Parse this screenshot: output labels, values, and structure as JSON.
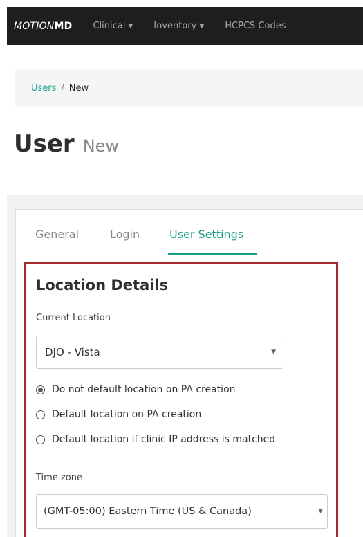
{
  "navbar": {
    "brand_part1": "MOTION",
    "brand_part2": "MD",
    "items": [
      {
        "label": "Clinical",
        "caret": "▼"
      },
      {
        "label": "Inventory",
        "caret": "▼"
      },
      {
        "label": "HCPCS Codes"
      }
    ]
  },
  "breadcrumb": {
    "link": "Users",
    "separator": "/",
    "current": "New"
  },
  "title": {
    "main": "User",
    "sub": "New"
  },
  "tabs": [
    {
      "label": "General",
      "active": false
    },
    {
      "label": "Login",
      "active": false
    },
    {
      "label": "User Settings",
      "active": true
    }
  ],
  "location_details": {
    "heading": "Location Details",
    "current_location_label": "Current Location",
    "current_location_value": "DJO - Vista",
    "radio_options": [
      {
        "label": "Do not default location on PA creation",
        "checked": true
      },
      {
        "label": "Default location on PA creation",
        "checked": false
      },
      {
        "label": "Default location if clinic IP address is matched",
        "checked": false
      }
    ],
    "time_zone_label": "Time zone",
    "time_zone_value": "(GMT-05:00) Eastern Time (US & Canada)"
  },
  "colors": {
    "accent": "#1a9e8a",
    "highlight_border": "#a32b2b",
    "navbar_bg": "#1e1e1e"
  }
}
